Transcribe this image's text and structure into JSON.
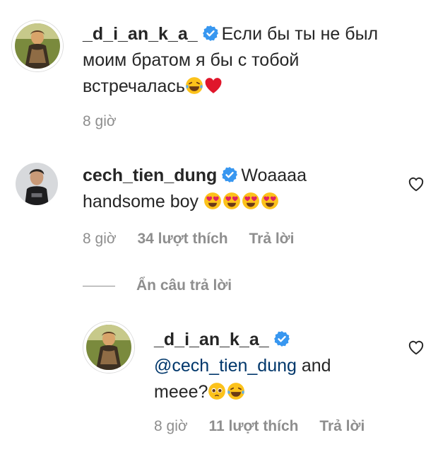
{
  "comments": [
    {
      "username": "_d_i_an_k_a_",
      "verified": true,
      "text_line1": "Если бы ты не был",
      "text_line2": "моим братом я бы с тобой",
      "text_line3": "встречалась",
      "emojis": [
        "face-with-tears-of-joy",
        "red-heart"
      ],
      "time": "8 giờ"
    },
    {
      "username": "cech_tien_dung",
      "verified": true,
      "text_line1": "Woaaaa",
      "text_line2": "handsome boy",
      "emojis": [
        "heart-eyes",
        "heart-eyes",
        "heart-eyes",
        "heart-eyes"
      ],
      "time": "8 giờ",
      "likes": "34 lượt thích",
      "reply": "Trả lời"
    }
  ],
  "hide_replies": "Ẩn câu trả lời",
  "reply": {
    "username": "_d_i_an_k_a_",
    "verified": true,
    "mention": "@cech_tien_dung",
    "text_after_mention": "and",
    "text_line2": "meee?",
    "emojis": [
      "pleading-face",
      "face-with-tears-of-joy"
    ],
    "time": "8 giờ",
    "likes": "11 lượt thích",
    "reply": "Trả lời"
  },
  "colors": {
    "verified": "#3897f0",
    "mention": "#00376b",
    "meta": "#8e8e8e"
  }
}
